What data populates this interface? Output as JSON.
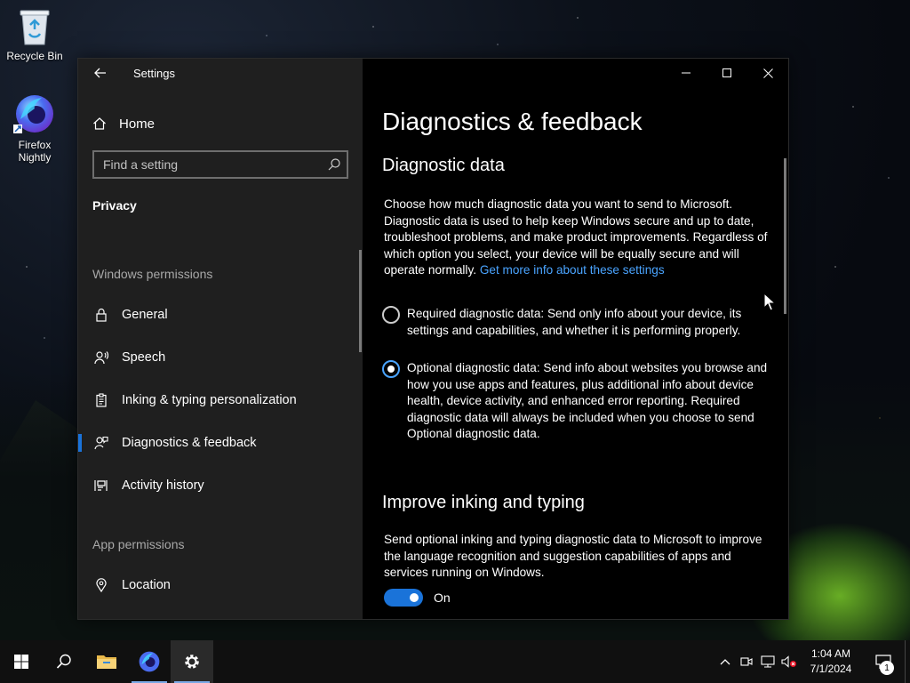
{
  "desktop": {
    "icons": [
      {
        "label": "Recycle Bin",
        "icon": "recycle-bin-icon"
      },
      {
        "label": "Firefox Nightly",
        "label_line1": "Firefox",
        "label_line2": "Nightly",
        "icon": "firefox-nightly-icon"
      }
    ]
  },
  "window": {
    "app_title": "Settings",
    "controls": [
      "minimize-icon",
      "maximize-icon",
      "close-icon"
    ]
  },
  "sidebar": {
    "home_label": "Home",
    "search_placeholder": "Find a setting",
    "category": "Privacy",
    "windows_permissions_header": "Windows permissions",
    "items": [
      {
        "label": "General",
        "icon": "lock-icon"
      },
      {
        "label": "Speech",
        "icon": "speech-icon"
      },
      {
        "label": "Inking & typing personalization",
        "icon": "clipboard-icon"
      },
      {
        "label": "Diagnostics & feedback",
        "icon": "feedback-icon",
        "selected": true
      },
      {
        "label": "Activity history",
        "icon": "timeline-icon"
      }
    ],
    "app_permissions_header": "App permissions",
    "app_items": [
      {
        "label": "Location",
        "icon": "location-icon"
      }
    ]
  },
  "main": {
    "page_title": "Diagnostics & feedback",
    "diagnostic_section": {
      "heading": "Diagnostic data",
      "description": "Choose how much diagnostic data you want to send to Microsoft. Diagnostic data is used to help keep Windows secure and up to date, troubleshoot problems, and make product improvements. Regardless of which option you select, your device will be equally secure and will operate normally.",
      "link": "Get more info about these settings",
      "options": [
        {
          "label": "Required diagnostic data: Send only info about your device, its settings and capabilities, and whether it is performing properly.",
          "checked": false
        },
        {
          "label": "Optional diagnostic data: Send info about websites you browse and how you use apps and features, plus additional info about device health, device activity, and enhanced error reporting. Required diagnostic data will always be included when you choose to send Optional diagnostic data.",
          "checked": true
        }
      ]
    },
    "inking_section": {
      "heading": "Improve inking and typing",
      "description": "Send optional inking and typing diagnostic data to Microsoft to improve the language recognition and suggestion capabilities of apps and services running on Windows.",
      "toggle_state": "On",
      "toggle_on": true
    }
  },
  "taskbar": {
    "buttons": [
      "windows-start-icon",
      "search-icon",
      "file-explorer-icon",
      "firefox-nightly-icon",
      "settings-gear-icon"
    ],
    "clock_time": "1:04 AM",
    "clock_date": "7/1/2024",
    "notification_count": "1",
    "tray_icons": [
      "chevron-up-icon",
      "meet-now-icon",
      "network-icon",
      "volume-muted-icon"
    ]
  },
  "colors": {
    "accent": "#1a73d9",
    "link": "#4aa4ff",
    "sidebar_bg": "#1f1f1f",
    "content_bg": "#000000"
  }
}
